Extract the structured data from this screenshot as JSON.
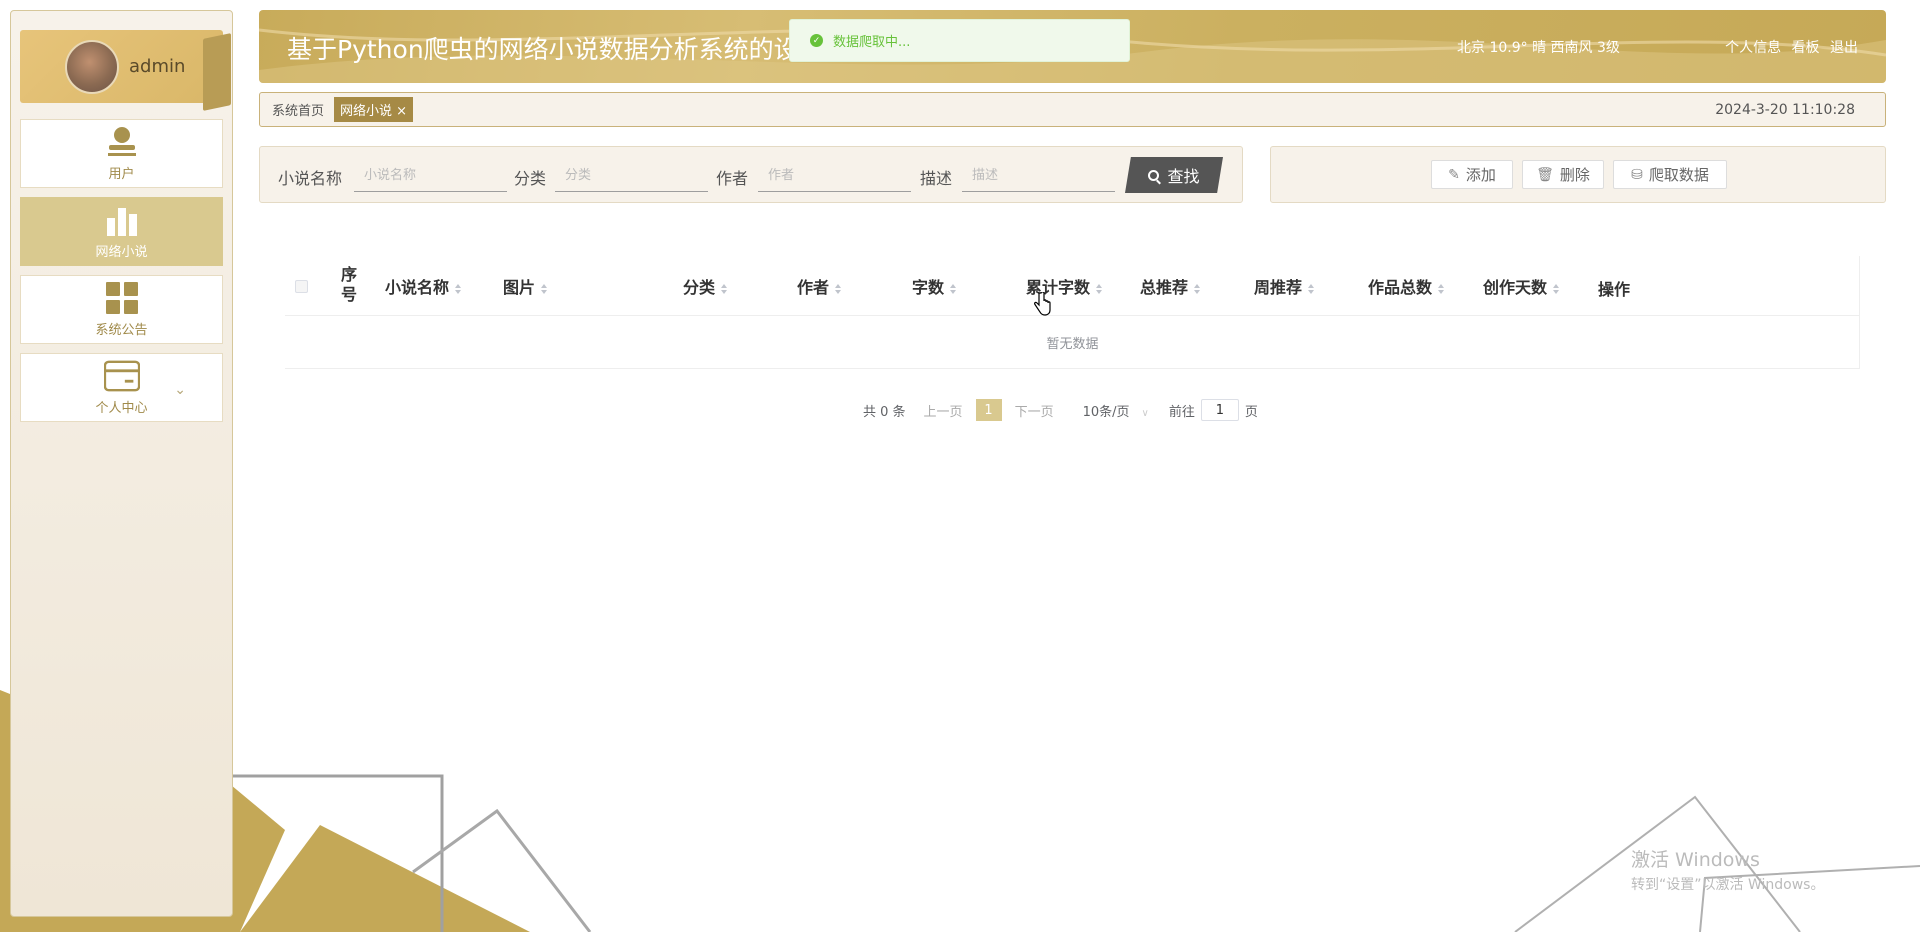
{
  "user": {
    "name": "admin"
  },
  "sidebar": {
    "items": [
      {
        "label": "用户",
        "icon": "user-icon",
        "active": false
      },
      {
        "label": "网络小说",
        "icon": "bar-chart-icon",
        "active": true
      },
      {
        "label": "系统公告",
        "icon": "grid-icon",
        "active": false
      },
      {
        "label": "个人中心",
        "icon": "card-icon",
        "active": false
      }
    ]
  },
  "header": {
    "title": "基于Python爬虫的网络小说数据分析系统的设计与实现",
    "weather": "北京 10.9° 晴 西南风 3级",
    "links": [
      "个人信息",
      "看板",
      "退出"
    ]
  },
  "toast": {
    "message": "数据爬取中..."
  },
  "breadcrumb": {
    "home": "系统首页",
    "current": "网络小说 ×",
    "datetime": "2024-3-20 11:10:28"
  },
  "search": {
    "fields": [
      {
        "label": "小说名称",
        "placeholder": "小说名称"
      },
      {
        "label": "分类",
        "placeholder": "分类"
      },
      {
        "label": "作者",
        "placeholder": "作者"
      },
      {
        "label": "描述",
        "placeholder": "描述"
      }
    ],
    "button": "查找"
  },
  "actions": {
    "add": "添加",
    "delete": "删除",
    "crawl": "爬取数据"
  },
  "table": {
    "columns": [
      "序号",
      "小说名称",
      "图片",
      "分类",
      "作者",
      "字数",
      "累计字数",
      "总推荐",
      "周推荐",
      "作品总数",
      "创作天数",
      "操作"
    ],
    "empty": "暂无数据"
  },
  "pager": {
    "total": "共 0 条",
    "prev": "上一页",
    "current": "1",
    "next": "下一页",
    "size": "10条/页",
    "goto_label": "前往",
    "goto_value": "1",
    "goto_unit": "页"
  },
  "watermark": {
    "line1": "激活 Windows",
    "line2": "转到“设置”以激活 Windows。"
  },
  "colors": {
    "accent": "#d9c98f",
    "header": "#c8ab5a",
    "success": "#67c23a"
  }
}
